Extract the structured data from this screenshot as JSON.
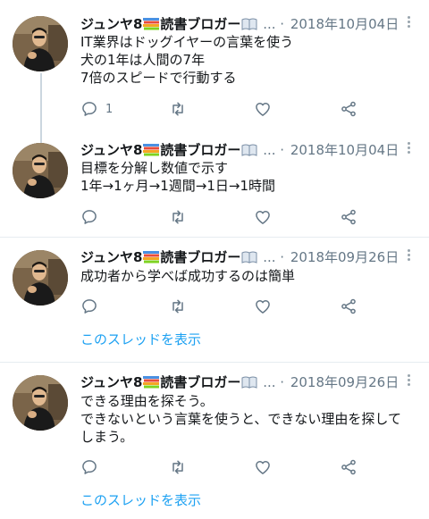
{
  "tweets": [
    {
      "name": "ジュンヤ8",
      "name_suffix": "読書ブロガー",
      "ellipsis": "...",
      "dot": "·",
      "date": "2018年10月04日",
      "lines": [
        "IT業界はドッグイヤーの言葉を使う",
        "犬の1年は人間の7年",
        "7倍のスピードで行動する"
      ],
      "reply_count": "1"
    },
    {
      "name": "ジュンヤ8",
      "name_suffix": "読書ブロガー",
      "ellipsis": "...",
      "dot": "·",
      "date": "2018年10月04日",
      "lines": [
        "目標を分解し数値で示す",
        "1年→1ヶ月→1週間→1日→1時間"
      ]
    },
    {
      "name": "ジュンヤ8",
      "name_suffix": "読書ブロガー",
      "ellipsis": "...",
      "dot": "·",
      "date": "2018年09月26日",
      "lines": [
        "成功者から学べば成功するのは簡単"
      ],
      "show_thread": "このスレッドを表示"
    },
    {
      "name": "ジュンヤ8",
      "name_suffix": "読書ブロガー",
      "ellipsis": "...",
      "dot": "·",
      "date": "2018年09月26日",
      "lines": [
        "できる理由を探そう。",
        "できないという言葉を使うと、できない理由を探して",
        "しまう。"
      ],
      "show_thread": "このスレッドを表示"
    }
  ],
  "icons": {
    "reply": "reply-icon",
    "retweet": "retweet-icon",
    "like": "heart-icon",
    "share": "share-icon",
    "more": "more-vertical-icon",
    "books": "books-emoji-icon",
    "open_book": "open-book-emoji-icon"
  },
  "colors": {
    "link": "#1da1f2",
    "secondary_text": "#657786",
    "divider": "#e6ecf0",
    "thread_line": "#cbd6df"
  }
}
